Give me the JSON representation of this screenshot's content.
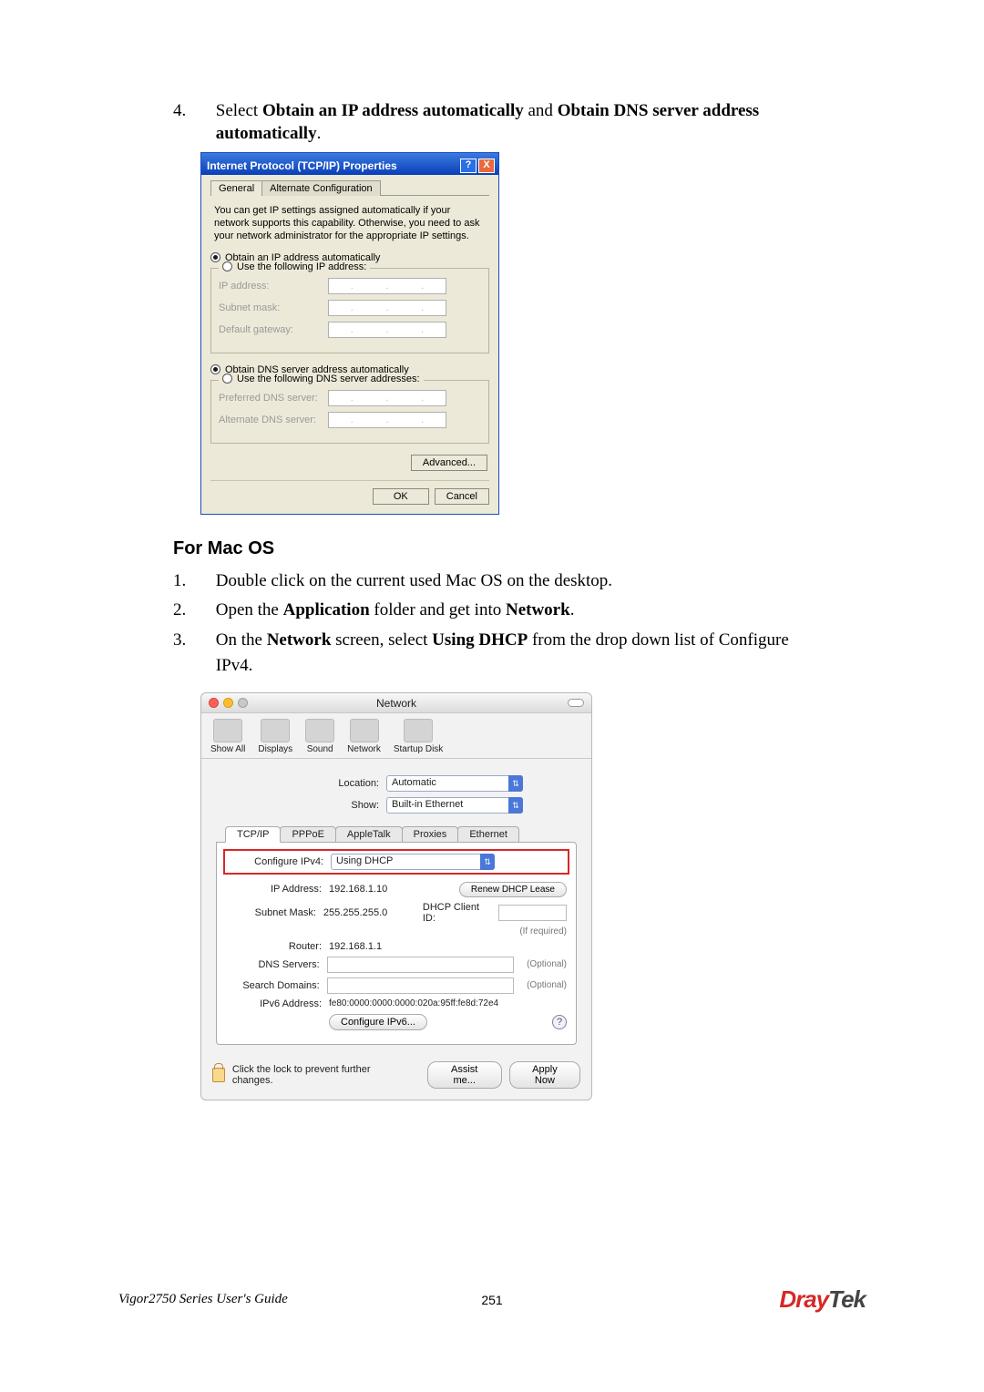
{
  "step4": {
    "num": "4.",
    "pre": "Select ",
    "b1": "Obtain an IP address automatically",
    "mid": " and ",
    "b2": "Obtain DNS server address automatically",
    "post": "."
  },
  "win": {
    "title": "Internet Protocol (TCP/IP) Properties",
    "help": "?",
    "close": "X",
    "tab_general": "General",
    "tab_alt": "Alternate Configuration",
    "desc": "You can get IP settings assigned automatically if your network supports this capability. Otherwise, you need to ask your network administrator for the appropriate IP settings.",
    "r_obtain_ip": "Obtain an IP address automatically",
    "r_use_ip": "Use the following IP address:",
    "lbl_ip": "IP address:",
    "lbl_subnet": "Subnet mask:",
    "lbl_gateway": "Default gateway:",
    "r_obtain_dns": "Obtain DNS server address automatically",
    "r_use_dns": "Use the following DNS server addresses:",
    "lbl_pref_dns": "Preferred DNS server:",
    "lbl_alt_dns": "Alternate DNS server:",
    "btn_adv": "Advanced...",
    "btn_ok": "OK",
    "btn_cancel": "Cancel"
  },
  "heading_mac": "For Mac OS",
  "mac_steps": {
    "s1": {
      "num": "1.",
      "text": "Double click on the current used Mac OS on the desktop."
    },
    "s2": {
      "num": "2.",
      "pre": "Open the ",
      "b1": "Application",
      "mid": " folder and get into ",
      "b2": "Network",
      "post": "."
    },
    "s3": {
      "num": "3.",
      "pre": "On the ",
      "b1": "Network",
      "mid1": " screen, select ",
      "b2": "Using DHCP",
      "mid2": " from the drop down list of Configure IPv4."
    }
  },
  "mac": {
    "title": "Network",
    "toolbar": {
      "showAll": "Show All",
      "displays": "Displays",
      "sound": "Sound",
      "network": "Network",
      "startup": "Startup Disk"
    },
    "location_label": "Location:",
    "location_value": "Automatic",
    "show_label": "Show:",
    "show_value": "Built-in Ethernet",
    "tabs": {
      "tcpip": "TCP/IP",
      "pppoe": "PPPoE",
      "appletalk": "AppleTalk",
      "proxies": "Proxies",
      "ethernet": "Ethernet"
    },
    "configure_label": "Configure IPv4:",
    "configure_value": "Using DHCP",
    "ip_label": "IP Address:",
    "ip_value": "192.168.1.10",
    "renew_btn": "Renew DHCP Lease",
    "subnet_label": "Subnet Mask:",
    "subnet_value": "255.255.255.0",
    "client_label": "DHCP Client ID:",
    "client_note": "(If required)",
    "router_label": "Router:",
    "router_value": "192.168.1.1",
    "dns_label": "DNS Servers:",
    "optional": "(Optional)",
    "search_label": "Search Domains:",
    "ipv6addr_label": "IPv6 Address:",
    "ipv6addr_value": "fe80:0000:0000:0000:020a:95ff:fe8d:72e4",
    "ipv6_btn": "Configure IPv6...",
    "help": "?",
    "lock_text": "Click the lock to prevent further changes.",
    "assist_btn": "Assist me...",
    "apply_btn": "Apply Now"
  },
  "footer": {
    "guide": "Vigor2750 Series User's Guide",
    "page": "251",
    "logo_d": "Dray",
    "logo_rest": "Tek"
  }
}
